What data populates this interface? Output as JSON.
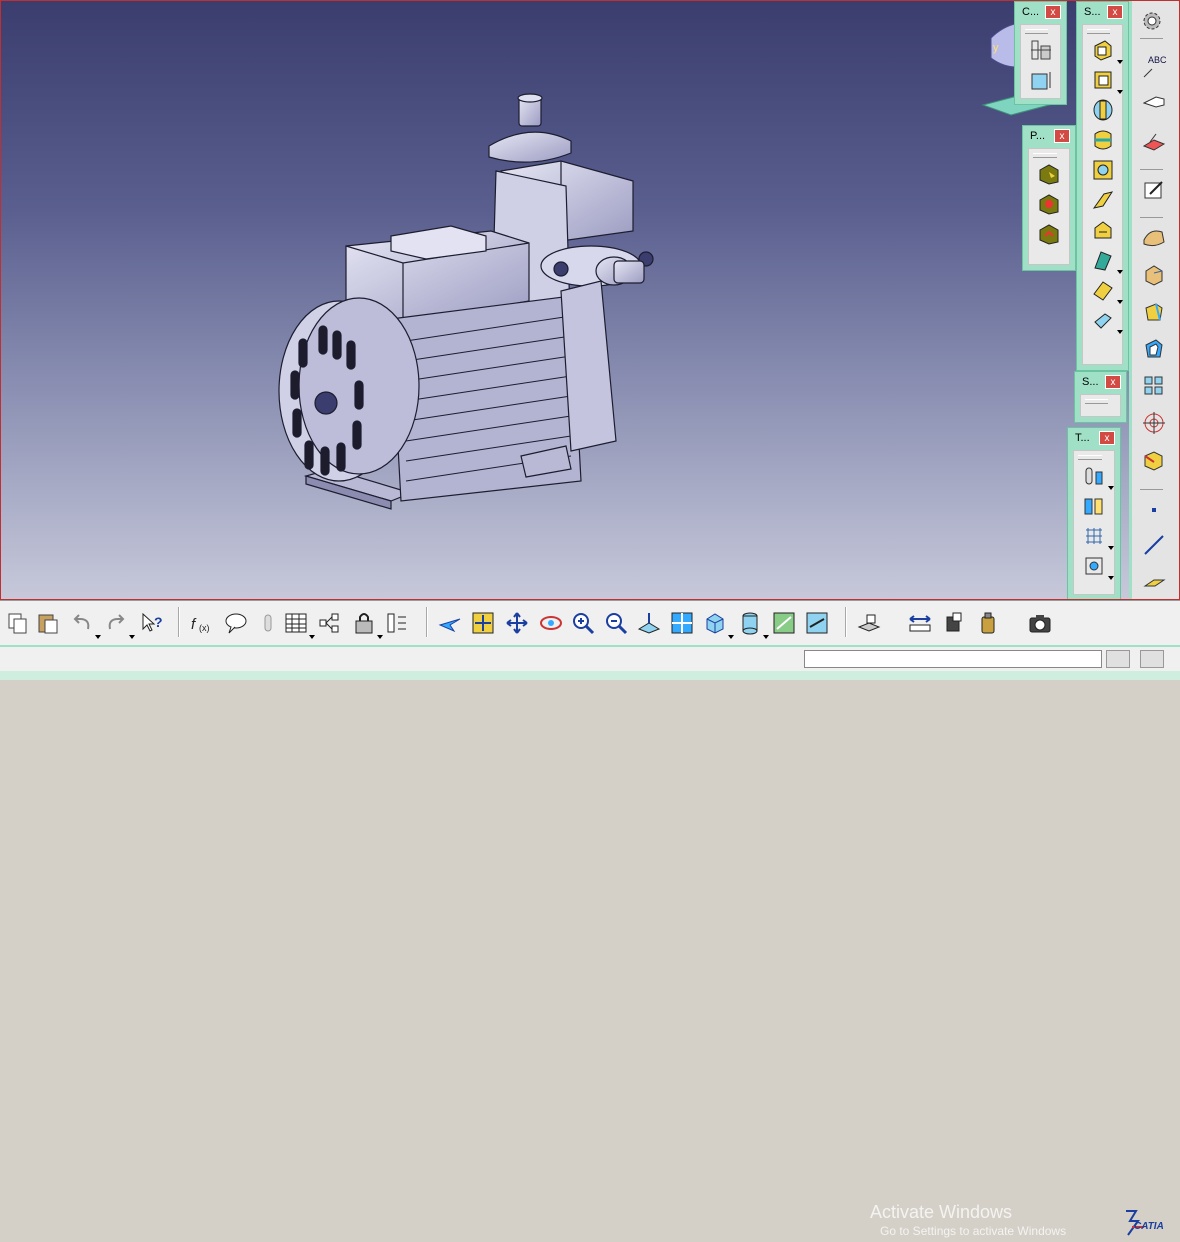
{
  "app": {
    "name": "CATIA"
  },
  "floating_toolbars": [
    {
      "id": "constraints",
      "title": "C...",
      "close": "x"
    },
    {
      "id": "surfaces",
      "title": "S...",
      "close": "x"
    },
    {
      "id": "part",
      "title": "P...",
      "close": "x"
    },
    {
      "id": "sketch",
      "title": "S...",
      "close": "x"
    },
    {
      "id": "tools",
      "title": "T...",
      "close": "x"
    }
  ],
  "compass": {
    "axis_label": "y"
  },
  "right_toolbar": {
    "text_icon_label": "ABC"
  },
  "watermark": {
    "title": "Activate Windows",
    "subtitle": "Go to Settings to activate Windows"
  },
  "logo": {
    "text": "CATIA",
    "mark": "3DS"
  },
  "status_bar": {
    "command_value": "",
    "command_placeholder": ""
  },
  "colors": {
    "toolbar_frame": "#9fe0c6",
    "close_button": "#d24a43",
    "viewport_top": "#3a3d6e",
    "viewport_bottom": "#c7c9da"
  }
}
